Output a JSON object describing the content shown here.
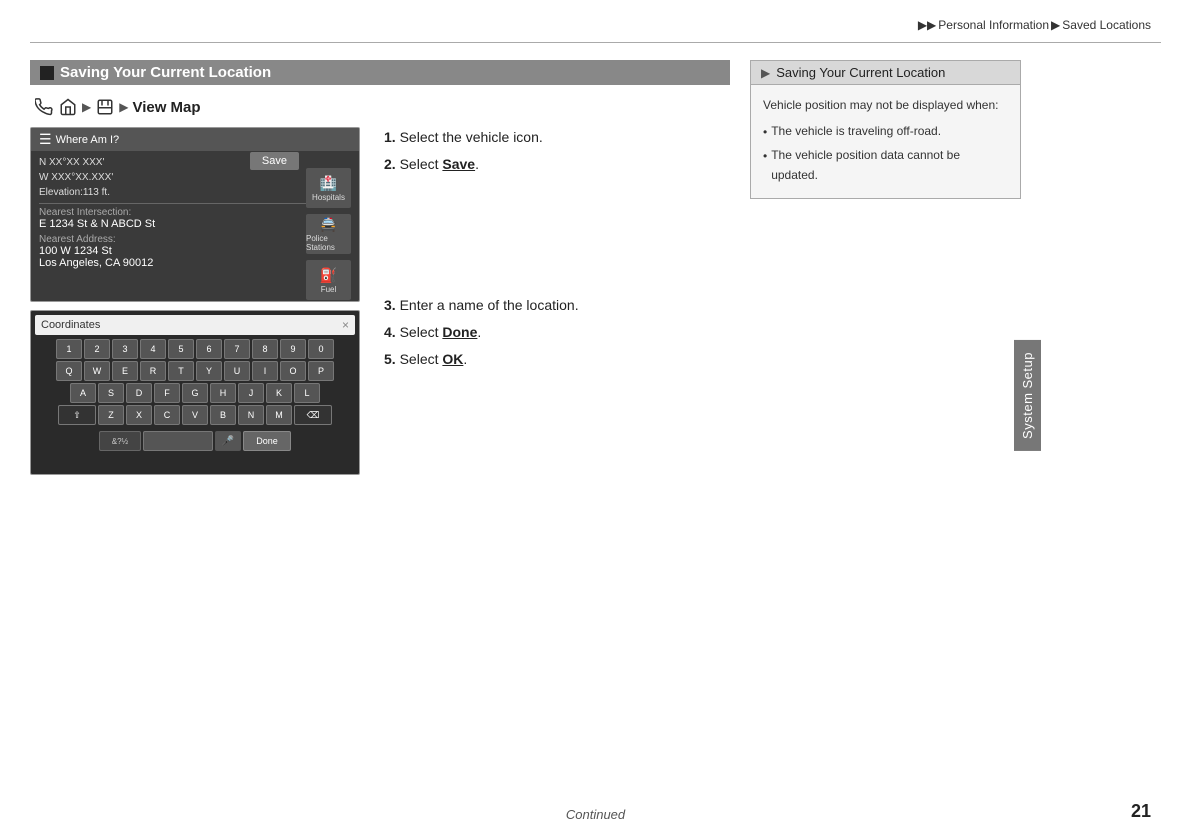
{
  "breadcrumb": {
    "prefix": "▶▶",
    "part1": "Personal Information",
    "arrow1": "▶",
    "part2": "Saved Locations"
  },
  "section": {
    "title": "Saving Your Current Location",
    "marker": "■"
  },
  "nav": {
    "phone_icon": "☎",
    "home_icon": "⌂",
    "arrow1": "▶",
    "save_icon": "⊟",
    "arrow2": "▶",
    "label": "View Map"
  },
  "screen1": {
    "title": "Where Am I?",
    "coords_line1": "N XX°XX XXX'",
    "coords_line2": "W XXX°XX.XXX'",
    "coords_line3": "Elevation:113 ft.",
    "intersection_label": "Nearest Intersection:",
    "intersection_value": "E 1234 St & N ABCD St",
    "address_label": "Nearest Address:",
    "address_line1": "100 W 1234 St",
    "address_line2": "Los Angeles, CA 90012",
    "save_btn": "Save",
    "side1": "Hospitals",
    "side2": "Police Stations",
    "side3": "Fuel"
  },
  "screen2": {
    "input_placeholder": "Coordinates",
    "clear_btn": "×",
    "rows": [
      [
        "1",
        "2",
        "3",
        "4",
        "5",
        "6",
        "7",
        "8",
        "9",
        "0"
      ],
      [
        "Q",
        "W",
        "E",
        "R",
        "T",
        "Y",
        "U",
        "I",
        "O",
        "P"
      ],
      [
        "A",
        "S",
        "D",
        "F",
        "G",
        "H",
        "J",
        "K",
        "L"
      ],
      [
        "⇧",
        "Z",
        "X",
        "C",
        "V",
        "B",
        "N",
        "M",
        "⌫"
      ]
    ],
    "bottom_symbols": "&?½",
    "bottom_spacebar": "",
    "bottom_mic": "🎤",
    "bottom_done": "Done"
  },
  "instructions": {
    "step1": "1.",
    "step1_text": " Select the vehicle icon.",
    "step2": "2.",
    "step2_text": " Select ",
    "step2_bold": "Save",
    "step2_end": ".",
    "step3": "3.",
    "step3_text": " Enter a name of the location.",
    "step4": "4.",
    "step4_text": " Select ",
    "step4_bold": "Done",
    "step4_end": ".",
    "step5": "5.",
    "step5_text": " Select ",
    "step5_bold": "OK",
    "step5_end": "."
  },
  "info_panel": {
    "header": "Saving Your Current Location",
    "intro": "Vehicle position may not be displayed when:",
    "bullet1": "The vehicle is traveling off-road.",
    "bullet2": "The vehicle position data cannot be updated."
  },
  "sidebar_label": "System Setup",
  "footer": {
    "continued": "Continued",
    "page": "21"
  }
}
